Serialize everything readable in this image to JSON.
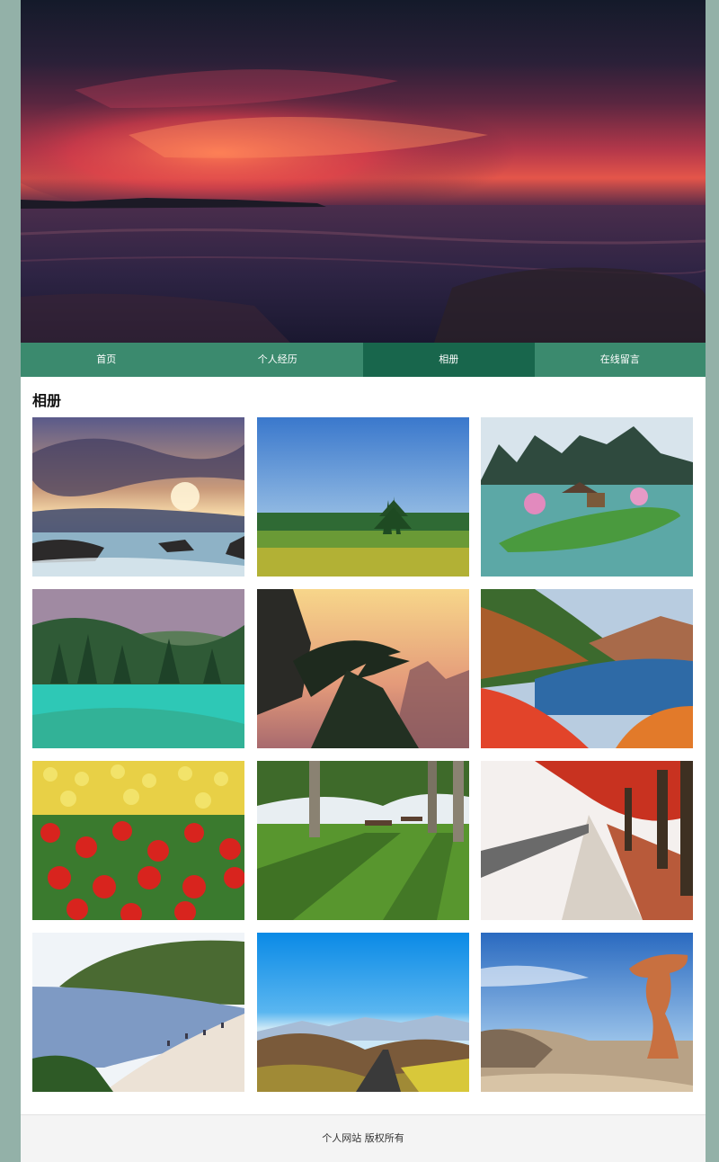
{
  "nav": {
    "items": [
      {
        "label": "首页",
        "active": false
      },
      {
        "label": "个人经历",
        "active": false
      },
      {
        "label": "相册",
        "active": true
      },
      {
        "label": "在线留言",
        "active": false
      }
    ]
  },
  "main": {
    "title": "相册",
    "photos": [
      {
        "name": "sunset-seascape-photo"
      },
      {
        "name": "meadow-pine-photo"
      },
      {
        "name": "karst-lake-island-photo"
      },
      {
        "name": "turquoise-lake-forest-photo"
      },
      {
        "name": "pine-silhouette-sunset-photo"
      },
      {
        "name": "autumn-lake-valley-photo"
      },
      {
        "name": "tulip-field-photo"
      },
      {
        "name": "park-lawn-benches-photo"
      },
      {
        "name": "red-tree-road-photo"
      },
      {
        "name": "beach-coast-photo"
      },
      {
        "name": "mountain-road-photo"
      },
      {
        "name": "rock-formation-photo"
      }
    ]
  },
  "footer": {
    "text": "个人网站 版权所有"
  },
  "colors": {
    "background": "#93b1a8",
    "nav": "#3b8a6e",
    "nav_active": "#18664c",
    "footer_bg": "#f4f4f4"
  }
}
